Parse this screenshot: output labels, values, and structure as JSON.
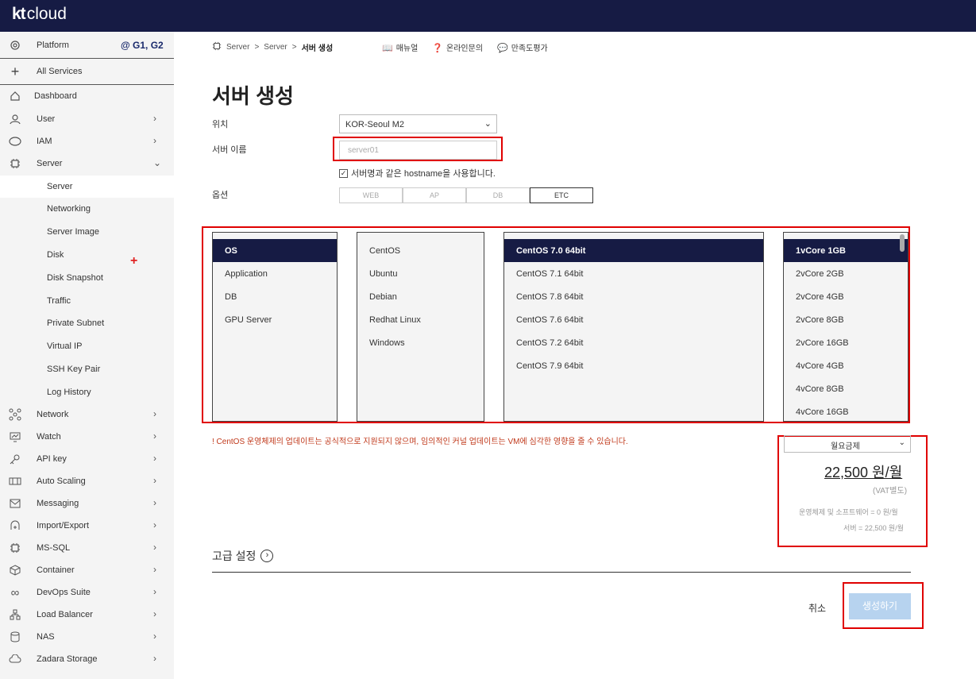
{
  "brand": {
    "logo_kt": "kt",
    "logo_cloud": "cloud"
  },
  "sidebar": {
    "platform": {
      "label": "Platform",
      "region": "@ G1, G2"
    },
    "all_services": "All Services",
    "items": [
      {
        "label": "Dashboard",
        "icon": "home-icon",
        "chevron": false
      },
      {
        "label": "User",
        "icon": "user-icon",
        "chevron": true
      },
      {
        "label": "IAM",
        "icon": "iam-icon",
        "chevron": true
      },
      {
        "label": "Server",
        "icon": "chip-icon",
        "chevron": true,
        "expanded": true
      }
    ],
    "server_sub": [
      "Server",
      "Networking",
      "Server Image",
      "Disk",
      "Disk Snapshot",
      "Traffic",
      "Private Subnet",
      "Virtual IP",
      "SSH Key Pair",
      "Log History"
    ],
    "items_after": [
      {
        "label": "Network",
        "icon": "network-icon"
      },
      {
        "label": "Watch",
        "icon": "monitor-icon"
      },
      {
        "label": "API key",
        "icon": "key-icon"
      },
      {
        "label": "Auto Scaling",
        "icon": "scaling-icon"
      },
      {
        "label": "Messaging",
        "icon": "mail-icon"
      },
      {
        "label": "Import/Export",
        "icon": "transfer-icon"
      },
      {
        "label": "MS-SQL",
        "icon": "chip-icon"
      },
      {
        "label": "Container",
        "icon": "box-icon"
      },
      {
        "label": "DevOps Suite",
        "icon": "infinity-icon"
      },
      {
        "label": "Load Balancer",
        "icon": "balancer-icon"
      },
      {
        "label": "NAS",
        "icon": "database-icon"
      },
      {
        "label": "Zadara Storage",
        "icon": "cloud-icon"
      }
    ]
  },
  "breadcrumb": {
    "items": [
      "Server",
      "Server"
    ],
    "current": "서버 생성"
  },
  "header_links": [
    "매뉴얼",
    "온라인문의",
    "만족도평가"
  ],
  "page": {
    "title": "서버 생성"
  },
  "form": {
    "location_label": "위치",
    "location_value": "KOR-Seoul M2",
    "name_label": "서버 이름",
    "name_placeholder": "server01",
    "hostname_check": "서버명과 같은 hostname을 사용합니다.",
    "option_label": "옵션",
    "option_tabs": [
      "WEB",
      "AP",
      "DB",
      "ETC"
    ],
    "option_selected": "ETC"
  },
  "lists": {
    "category": [
      "OS",
      "Application",
      "DB",
      "GPU Server"
    ],
    "os_family": [
      "CentOS",
      "Ubuntu",
      "Debian",
      "Redhat Linux",
      "Windows"
    ],
    "os_version": [
      "CentOS 7.0 64bit",
      "CentOS 7.1 64bit",
      "CentOS 7.8 64bit",
      "CentOS 7.6 64bit",
      "CentOS 7.2 64bit",
      "CentOS 7.9 64bit"
    ],
    "spec": [
      "1vCore 1GB",
      "2vCore 2GB",
      "2vCore 4GB",
      "2vCore 8GB",
      "2vCore 16GB",
      "4vCore 4GB",
      "4vCore 8GB",
      "4vCore 16GB"
    ]
  },
  "warning": "! CentOS 운영체제의 업데이트는 공식적으로 지원되지 않으며, 임의적인 커널 업데이트는 VM에 심각한 영향을 줄 수 있습니다.",
  "billing": {
    "plan": "월요금제",
    "price": "22,500 원/월",
    "vat": "(VAT별도)",
    "os_sw": "운영체제 및 소프트웨어 = 0 원/월",
    "server": "서버 = 22,500 원/월"
  },
  "advanced": "고급 설정",
  "actions": {
    "cancel": "취소",
    "create": "생성하기"
  },
  "colors": {
    "nav": "#161b44",
    "selected": "#161b44",
    "highlight": "#e00000",
    "create_btn": "#b7d3ef"
  }
}
